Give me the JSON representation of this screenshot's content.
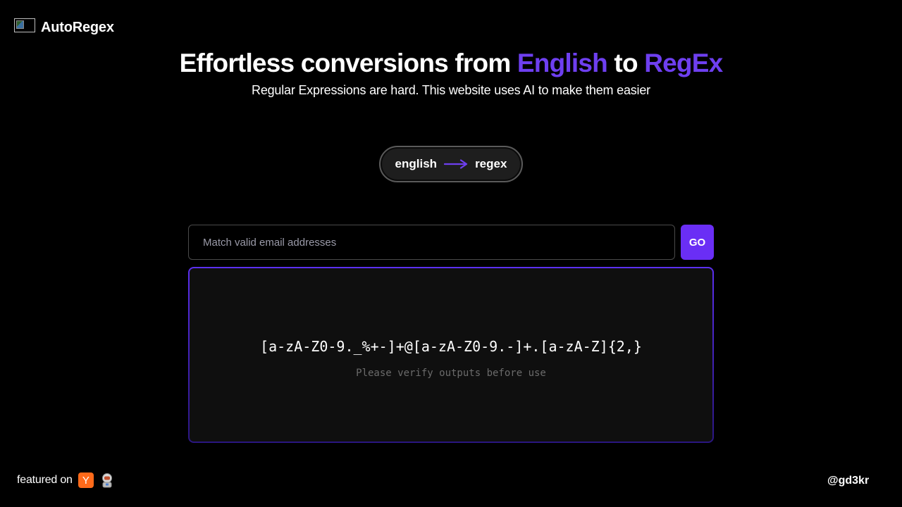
{
  "brand": {
    "name": "AutoRegex",
    "logo_icon": "broken-image-icon"
  },
  "hero": {
    "title_part1": "Effortless conversions from ",
    "title_english": "English",
    "title_to": " to ",
    "title_regex": "RegEx",
    "subtitle": "Regular Expressions are hard. This website uses AI to make them easier"
  },
  "mode_toggle": {
    "from_label": "english",
    "to_label": "regex",
    "arrow_icon": "arrow-right-icon"
  },
  "input": {
    "placeholder": "Match valid email addresses",
    "value": "",
    "go_label": "GO"
  },
  "output": {
    "regex": "[a-zA-Z0-9._%+-]+@[a-zA-Z0-9.-]+.[a-zA-Z]{2,}",
    "note": "Please verify outputs before use"
  },
  "footer": {
    "featured_label": "featured on",
    "yc_badge_text": "Y",
    "handle": "@gd3kr"
  },
  "colors": {
    "background": "#000000",
    "accent": "#6e3ff0",
    "go_button": "#6a2ef5",
    "yc_orange": "#ff6a1a",
    "panel_bg": "#0f0f0f"
  }
}
